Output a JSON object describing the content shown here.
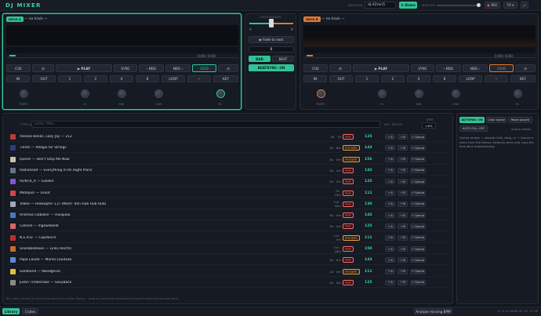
{
  "app": {
    "title": "DJ MIXER"
  },
  "header": {
    "session_label": "SESSION",
    "session_value": "dj-42mn5",
    "share_label": "⇅ Share",
    "master_label": "MASTER",
    "rec_label": "REC",
    "fx_label": "FX"
  },
  "deck_a": {
    "tag": "DECK A",
    "track": "— no track —",
    "time": "0:00 / 0:00",
    "transport": {
      "cue": "CUE",
      "loop_icon": "headphones-icon",
      "play": "▶ PLAY",
      "sync": "SYNC",
      "nudge_back": "‹ NDG",
      "nudge_fwd": "NDG ›",
      "grid": "GRID",
      "reset": "⊘"
    },
    "loop_row": [
      "IN",
      "OUT",
      "1",
      "2",
      "4",
      "8",
      "LOOP",
      "−",
      "KEY"
    ],
    "knobs": [
      "TEMPO",
      "HI",
      "MID",
      "LOW",
      "FIL"
    ],
    "accent": "#2fc497"
  },
  "deck_b": {
    "tag": "DECK B",
    "track": "— no track —",
    "time": "0:00 / 0:00",
    "transport": {
      "cue": "CUE",
      "loop_icon": "headphones-icon",
      "play": "▶ PLAY",
      "sync": "SYNC",
      "nudge_back": "‹ NDG",
      "nudge_fwd": "NDG ›",
      "grid": "GRID",
      "reset": "⊘"
    },
    "loop_row": [
      "IN",
      "OUT",
      "1",
      "2",
      "4",
      "8",
      "LOOP",
      "−",
      "KEY"
    ],
    "knobs": [
      "TEMPO",
      "HI",
      "MID",
      "LOW",
      "FIL"
    ],
    "accent": "#e07a36"
  },
  "mixer": {
    "crossfader_label": "CROSSFADER",
    "a": "A",
    "b": "B",
    "fade_label": "▶ Fade to next",
    "bars_value": "8",
    "bar_label": "BAR",
    "beat_label": "BEAT",
    "beatsync_label": "BEATSYNC: ON"
  },
  "library": {
    "type_label": "TYPE ▸",
    "search_placeholder": "artist, title...",
    "cols": {
      "key": "KEY",
      "mood": "MOOD",
      "bpm": "BPM"
    },
    "bpm_filter_label": "BPM",
    "bpm_filter_value": "±6%",
    "tracks": [
      {
        "title": "Azealia Banks, Lazy Jay — 212",
        "key": "2B · 7A",
        "energy": "Peak",
        "energy_class": "peak",
        "bpm": "125",
        "cover": "#b83a3a"
      },
      {
        "title": "Tiësto — Adagio for Strings",
        "key": "9A · 8m",
        "energy": "Energetic",
        "energy_class": "energetic",
        "bpm": "143",
        "cover": "#2c3e80"
      },
      {
        "title": "Queen — Don't Stop Me Now",
        "key": "8A · 0m",
        "energy": "Energetic",
        "energy_class": "energetic",
        "bpm": "156",
        "cover": "#c8c0a8"
      },
      {
        "title": "Radiohead — Everything In Its Right Place",
        "key": "5A · 0m",
        "energy": "Peak",
        "energy_class": "peak",
        "bpm": "143",
        "cover": "#6a7280"
      },
      {
        "title": "HUNTR_X — Golden",
        "key": "9A · 5m",
        "energy": "Peak",
        "energy_class": "peak",
        "bpm": "125",
        "cover": "#7a5ad0"
      },
      {
        "title": "Metejoor — Groot",
        "key": "7A · 10m",
        "energy": "Peak",
        "energy_class": "peak",
        "bpm": "111",
        "cover": "#d04848"
      },
      {
        "title": "Tobee — Helikopter 117 (Mach' den Hub Hub Hub)",
        "key": "11A · 16m",
        "energy": "Peak",
        "energy_class": "peak",
        "bpm": "130",
        "cover": "#a0a8b8"
      },
      {
        "title": "Andreas Gabalier — Hulapalu",
        "key": "6A · 0m",
        "energy": "Peak",
        "energy_class": "peak",
        "bpm": "143",
        "cover": "#4a78c0"
      },
      {
        "title": "Camille — Ingewikkeld",
        "key": "5A · 0m",
        "energy": "Peak",
        "energy_class": "peak",
        "bpm": "125",
        "cover": "#d86868"
      },
      {
        "title": "N.E.R.D. — Lapdance",
        "key": "11A · 0m",
        "energy": "Energetic",
        "energy_class": "energetic",
        "bpm": "111",
        "cover": "#b83030"
      },
      {
        "title": "Snollebollekes — Links Rechts",
        "key": "11A · 18m",
        "energy": "Peak",
        "energy_class": "peak",
        "bpm": "150",
        "cover": "#c86a30"
      },
      {
        "title": "Papa Lauda — Mama Laudaaa",
        "key": "9A · 0m",
        "energy": "Peak",
        "energy_class": "peak",
        "bpm": "143",
        "cover": "#5a8ad8"
      },
      {
        "title": "Goldband — Noodgeval",
        "key": "4A · 0m",
        "energy": "Energetic",
        "energy_class": "energetic",
        "bpm": "111",
        "cover": "#e0c040"
      },
      {
        "title": "Justin Timberlake — SexyBack",
        "key": "9A · 0m",
        "energy": "Peak",
        "energy_class": "peak",
        "bpm": "125",
        "cover": "#8a8a8a"
      }
    ],
    "row_buttons": {
      "a": "→ A",
      "b": "→ B",
      "queue": "+ Queue"
    },
    "footer_tip": "Tip: press [Enter] in search to query the online library · drag an audio file anywhere to load it onto the focused deck"
  },
  "queue": {
    "automix_label": "AUTOMIX: ON",
    "clear_label": "Clear queue",
    "reset_label": "Reset played",
    "autofill_label": "AUTO-FILL: OFF",
    "status": "queue empty",
    "empty_text": "Queue empty — double-click, drag, or + Queue a track from the library. Automix arms and cues the first deck automatically."
  },
  "bottom": {
    "tab_library": "Library",
    "tab_crates": "Crates",
    "analyze_label": "Analyze missing BPM",
    "version": "v2.8.0·c3028·05-22 21:28"
  }
}
